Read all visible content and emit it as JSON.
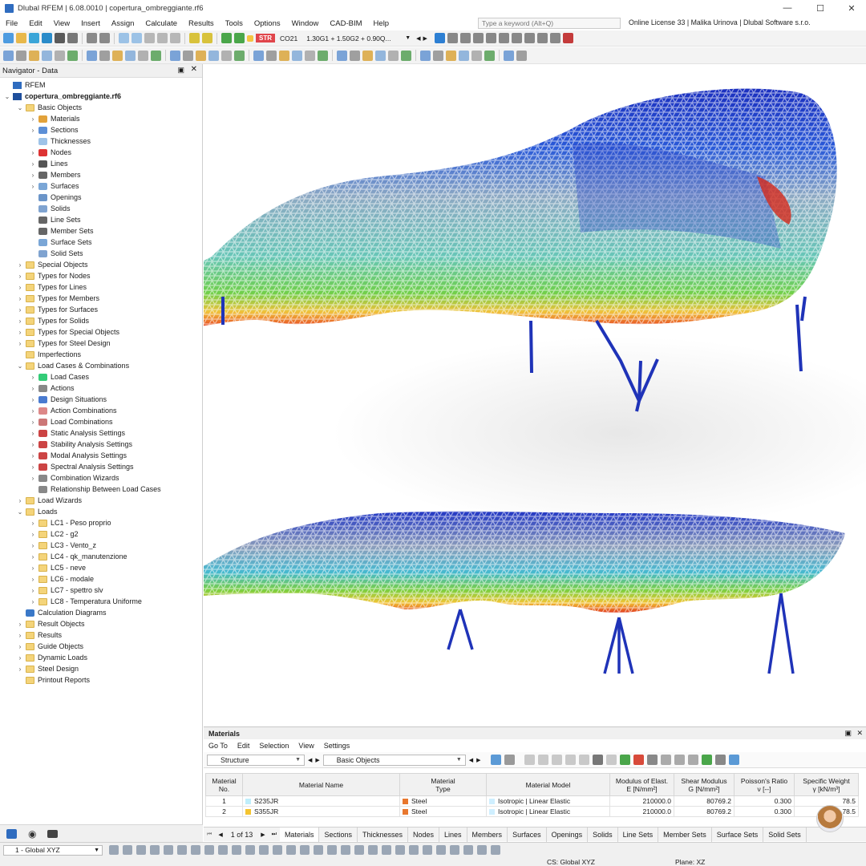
{
  "window": {
    "title": "Dlubal RFEM | 6.08.0010 | copertura_ombreggiante.rf6",
    "minimize_icon": "minimize-icon",
    "maximize_icon": "maximize-icon",
    "close_icon": "close-icon"
  },
  "menu": {
    "items": [
      "File",
      "Edit",
      "View",
      "Insert",
      "Assign",
      "Calculate",
      "Results",
      "Tools",
      "Options",
      "Window",
      "CAD-BIM",
      "Help"
    ],
    "search_placeholder": "Type a keyword (Alt+Q)",
    "license": "Online License 33 | Malika Urinova | Dlubal Software s.r.o."
  },
  "toolbar": {
    "design_badge": "STR",
    "combo_name": "CO21",
    "combo_formula": "1.30G1 + 1.50G2 + 0.90Q...",
    "design_badge_color": "#e0454b"
  },
  "navigator": {
    "title": "Navigator - Data",
    "root": "RFEM",
    "file": "copertura_ombreggiante.rf6",
    "items": [
      {
        "label": "Basic Objects",
        "level": 1,
        "icon": "folder",
        "tw": "v"
      },
      {
        "label": "Materials",
        "level": 2,
        "icon": "materials",
        "tw": ">"
      },
      {
        "label": "Sections",
        "level": 2,
        "icon": "sections",
        "tw": ">"
      },
      {
        "label": "Thicknesses",
        "level": 2,
        "icon": "thickness",
        "tw": ""
      },
      {
        "label": "Nodes",
        "level": 2,
        "icon": "node",
        "tw": ">"
      },
      {
        "label": "Lines",
        "level": 2,
        "icon": "line",
        "tw": ">"
      },
      {
        "label": "Members",
        "level": 2,
        "icon": "member",
        "tw": ">"
      },
      {
        "label": "Surfaces",
        "level": 2,
        "icon": "surface",
        "tw": ">"
      },
      {
        "label": "Openings",
        "level": 2,
        "icon": "opening",
        "tw": ""
      },
      {
        "label": "Solids",
        "level": 2,
        "icon": "solid",
        "tw": ""
      },
      {
        "label": "Line Sets",
        "level": 2,
        "icon": "lineset",
        "tw": ""
      },
      {
        "label": "Member Sets",
        "level": 2,
        "icon": "memberset",
        "tw": ""
      },
      {
        "label": "Surface Sets",
        "level": 2,
        "icon": "surfaceset",
        "tw": ""
      },
      {
        "label": "Solid Sets",
        "level": 2,
        "icon": "solidset",
        "tw": ""
      },
      {
        "label": "Special Objects",
        "level": 1,
        "icon": "folder",
        "tw": ">"
      },
      {
        "label": "Types for Nodes",
        "level": 1,
        "icon": "folder",
        "tw": ">"
      },
      {
        "label": "Types for Lines",
        "level": 1,
        "icon": "folder",
        "tw": ">"
      },
      {
        "label": "Types for Members",
        "level": 1,
        "icon": "folder",
        "tw": ">"
      },
      {
        "label": "Types for Surfaces",
        "level": 1,
        "icon": "folder",
        "tw": ">"
      },
      {
        "label": "Types for Solids",
        "level": 1,
        "icon": "folder",
        "tw": ">"
      },
      {
        "label": "Types for Special Objects",
        "level": 1,
        "icon": "folder",
        "tw": ">"
      },
      {
        "label": "Types for Steel Design",
        "level": 1,
        "icon": "folder",
        "tw": ">"
      },
      {
        "label": "Imperfections",
        "level": 1,
        "icon": "folder",
        "tw": ""
      },
      {
        "label": "Load Cases & Combinations",
        "level": 1,
        "icon": "folder",
        "tw": "v"
      },
      {
        "label": "Load Cases",
        "level": 2,
        "icon": "loadcase",
        "tw": ">"
      },
      {
        "label": "Actions",
        "level": 2,
        "icon": "action",
        "tw": ">"
      },
      {
        "label": "Design Situations",
        "level": 2,
        "icon": "designsit",
        "tw": ">"
      },
      {
        "label": "Action Combinations",
        "level": 2,
        "icon": "actioncomb",
        "tw": ">"
      },
      {
        "label": "Load Combinations",
        "level": 2,
        "icon": "loadcomb",
        "tw": ">"
      },
      {
        "label": "Static Analysis Settings",
        "level": 2,
        "icon": "static",
        "tw": ">"
      },
      {
        "label": "Stability Analysis Settings",
        "level": 2,
        "icon": "stability",
        "tw": ">"
      },
      {
        "label": "Modal Analysis Settings",
        "level": 2,
        "icon": "modal",
        "tw": ">"
      },
      {
        "label": "Spectral Analysis Settings",
        "level": 2,
        "icon": "spectral",
        "tw": ">"
      },
      {
        "label": "Combination Wizards",
        "level": 2,
        "icon": "wizard",
        "tw": ">"
      },
      {
        "label": "Relationship Between Load Cases",
        "level": 2,
        "icon": "relation",
        "tw": ""
      },
      {
        "label": "Load Wizards",
        "level": 1,
        "icon": "folder",
        "tw": ">"
      },
      {
        "label": "Loads",
        "level": 1,
        "icon": "folder",
        "tw": "v"
      },
      {
        "label": "LC1 - Peso proprio",
        "level": 2,
        "icon": "folder",
        "tw": ">"
      },
      {
        "label": "LC2 - g2",
        "level": 2,
        "icon": "folder",
        "tw": ">"
      },
      {
        "label": "LC3 - Vento_z",
        "level": 2,
        "icon": "folder",
        "tw": ">"
      },
      {
        "label": "LC4 - qk_manutenzione",
        "level": 2,
        "icon": "folder",
        "tw": ">"
      },
      {
        "label": "LC5 - neve",
        "level": 2,
        "icon": "folder",
        "tw": ">"
      },
      {
        "label": "LC6 - modale",
        "level": 2,
        "icon": "folder",
        "tw": ">"
      },
      {
        "label": "LC7 - spettro slv",
        "level": 2,
        "icon": "folder",
        "tw": ">"
      },
      {
        "label": "LC8 - Temperatura Uniforme",
        "level": 2,
        "icon": "folder",
        "tw": ">"
      },
      {
        "label": "Calculation Diagrams",
        "level": 1,
        "icon": "calcdiag",
        "tw": ""
      },
      {
        "label": "Result Objects",
        "level": 1,
        "icon": "folder",
        "tw": ">"
      },
      {
        "label": "Results",
        "level": 1,
        "icon": "folder",
        "tw": ">"
      },
      {
        "label": "Guide Objects",
        "level": 1,
        "icon": "folder",
        "tw": ">"
      },
      {
        "label": "Dynamic Loads",
        "level": 1,
        "icon": "folder",
        "tw": ">"
      },
      {
        "label": "Steel Design",
        "level": 1,
        "icon": "folder",
        "tw": ">"
      },
      {
        "label": "Printout Reports",
        "level": 1,
        "icon": "folder",
        "tw": ""
      }
    ]
  },
  "panel": {
    "title": "Materials",
    "menu": [
      "Go To",
      "Edit",
      "Selection",
      "View",
      "Settings"
    ],
    "combo_left": "Structure",
    "combo_right": "Basic Objects",
    "columns": [
      {
        "l1": "Material",
        "l2": "No."
      },
      {
        "l1": "",
        "l2": "Material Name"
      },
      {
        "l1": "Material",
        "l2": "Type"
      },
      {
        "l1": "",
        "l2": "Material Model"
      },
      {
        "l1": "Modulus of Elast.",
        "l2": "E [N/mm²]"
      },
      {
        "l1": "Shear Modulus",
        "l2": "G [N/mm²]"
      },
      {
        "l1": "Poisson's Ratio",
        "l2": "ν [--]"
      },
      {
        "l1": "Specific Weight",
        "l2": "γ [kN/m³]"
      }
    ],
    "rows": [
      {
        "no": "1",
        "name": "S235JR",
        "name_color": "#bfeefb",
        "type": "Steel",
        "type_color": "#e8772e",
        "model": "Isotropic | Linear Elastic",
        "E": "210000.0",
        "G": "80769.2",
        "nu": "0.300",
        "gamma": "78.5"
      },
      {
        "no": "2",
        "name": "S355JR",
        "name_color": "#f4c430",
        "type": "Steel",
        "type_color": "#e8772e",
        "model": "Isotropic | Linear Elastic",
        "E": "210000.0",
        "G": "80769.2",
        "nu": "0.300",
        "gamma": "78.5"
      }
    ],
    "pager": "1 of 13",
    "tabs": [
      "Materials",
      "Sections",
      "Thicknesses",
      "Nodes",
      "Lines",
      "Members",
      "Surfaces",
      "Openings",
      "Solids",
      "Line Sets",
      "Member Sets",
      "Surface Sets",
      "Solid Sets"
    ]
  },
  "status": {
    "cs_select": "1 - Global XYZ",
    "cs": "CS: Global XYZ",
    "plane": "Plane: XZ"
  }
}
